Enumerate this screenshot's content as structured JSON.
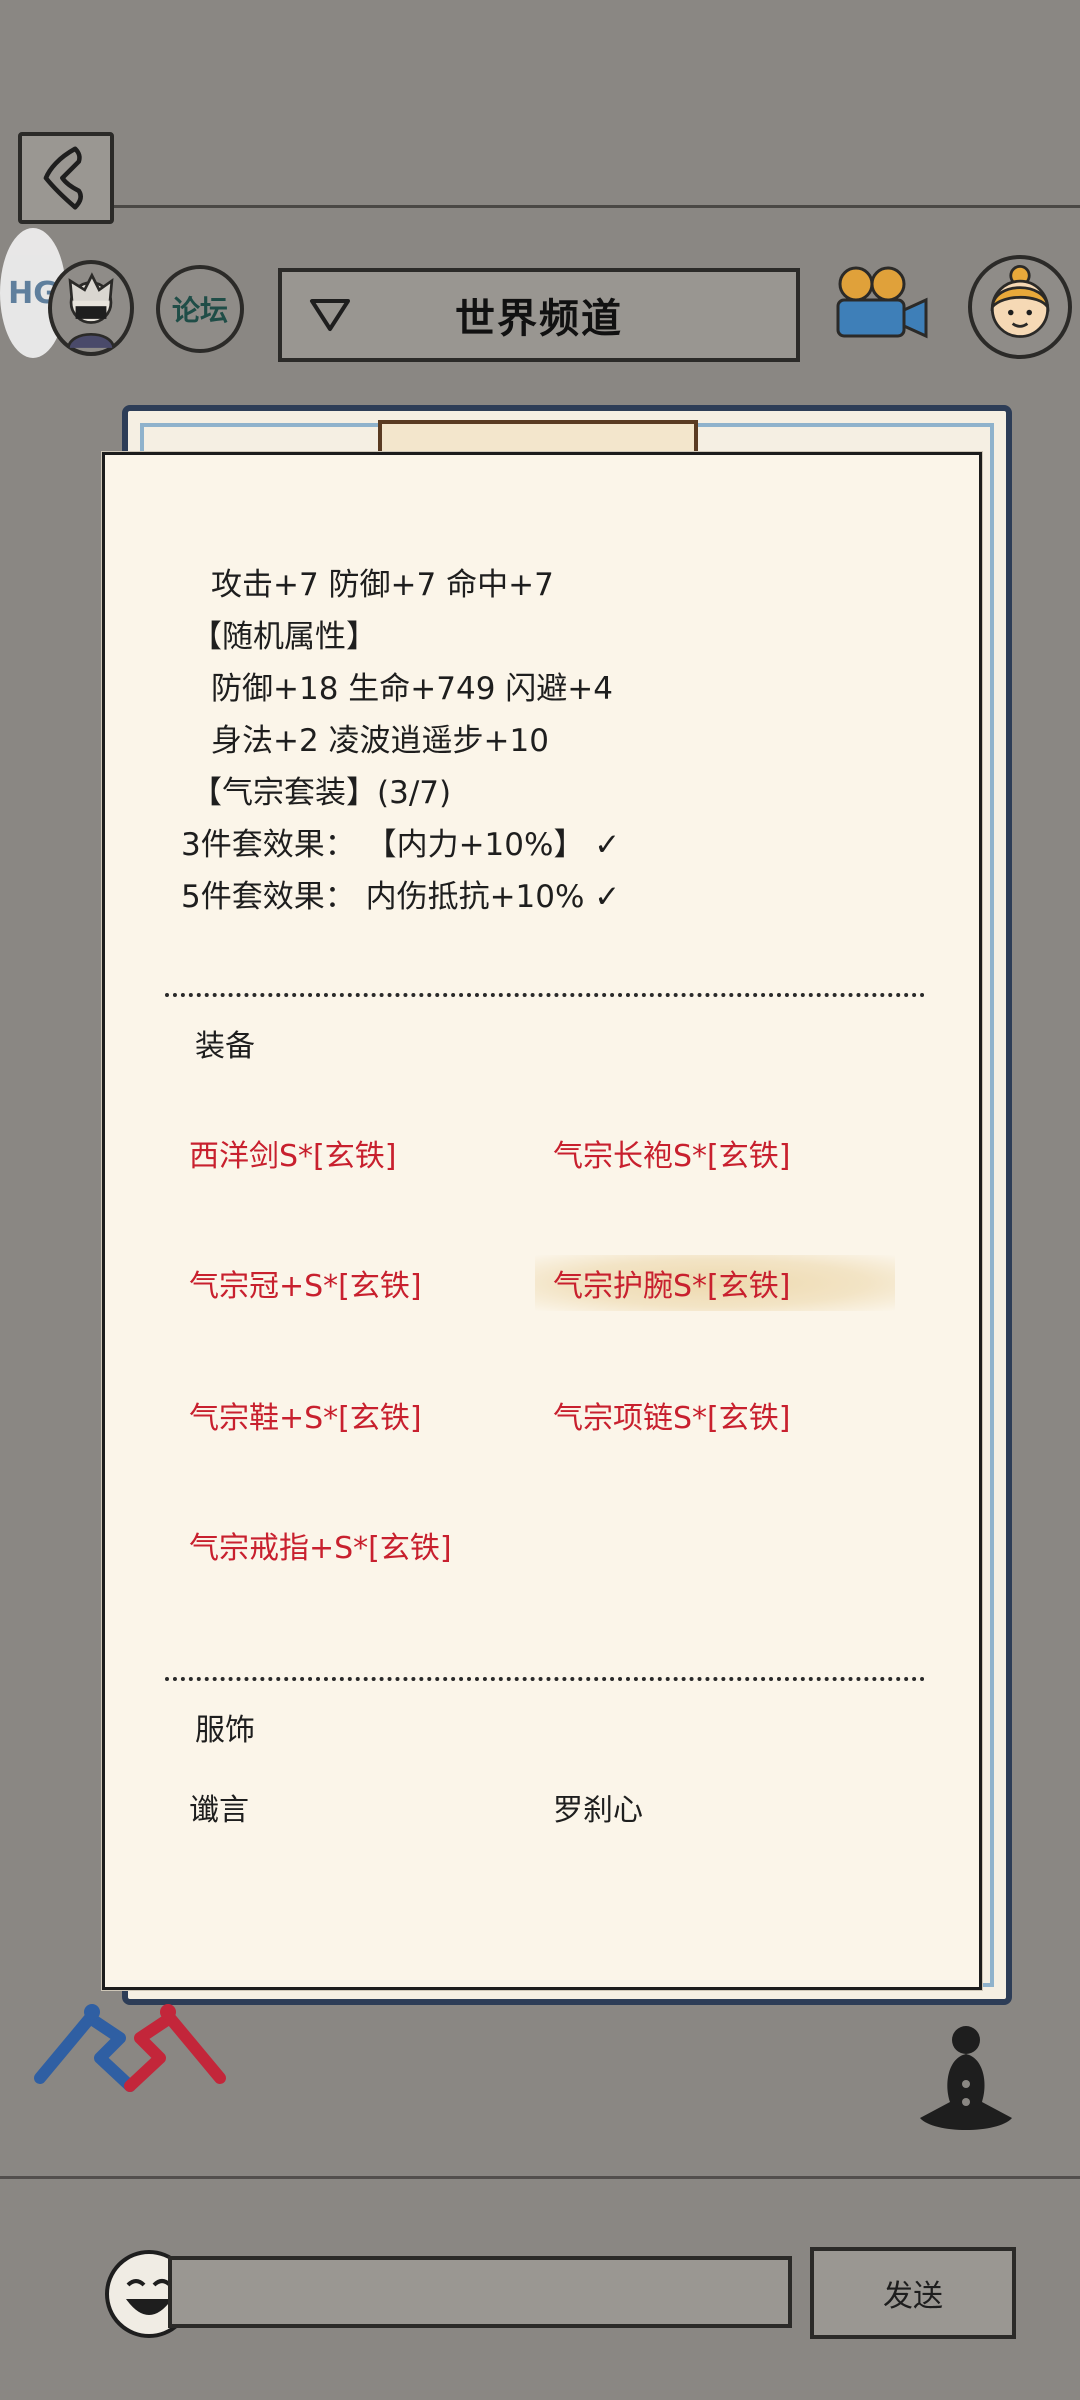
{
  "header": {
    "channel_title": "世界频道",
    "forum_label": "论坛",
    "badge_text": "HG"
  },
  "card": {
    "stats_lines": [
      "攻击+7 防御+7 命中+7",
      "【随机属性】",
      "防御+18 生命+749 闪避+4",
      "身法+2 凌波逍遥步+10",
      "【气宗套装】(3/7)",
      "3件套效果： 【内力+10%】 ✓",
      "5件套效果： 内伤抵抗+10% ✓"
    ],
    "equipment_title": "装备",
    "equipment": [
      "西洋剑S*[玄铁]",
      "气宗长袍S*[玄铁]",
      "气宗冠+S*[玄铁]",
      "气宗护腕S*[玄铁]",
      "气宗鞋+S*[玄铁]",
      "气宗项链S*[玄铁]",
      "气宗戒指+S*[玄铁]"
    ],
    "costume_title": "服饰",
    "costumes": [
      "谶言",
      "罗刹心"
    ]
  },
  "footer": {
    "send_label": "发送",
    "input_value": ""
  },
  "colors": {
    "background": "#8a8783",
    "card": "#fbf5e9",
    "equipment_text": "#c8202e",
    "frame_blue": "#2d3d57"
  },
  "icons": [
    "back-arrow-icon",
    "dropdown-triangle-icon",
    "camera-icon",
    "smiley-face-icon",
    "pvp-fighters-icon",
    "meditation-icon"
  ]
}
